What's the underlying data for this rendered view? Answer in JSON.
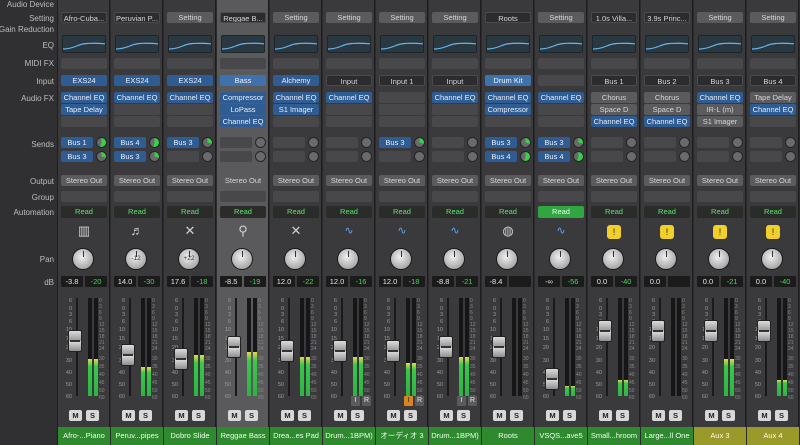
{
  "row_labels": {
    "audio_device": "Audio Device",
    "setting": "Setting",
    "gain_reduction": "Gain Reduction",
    "eq": "EQ",
    "midi_fx": "MIDI FX",
    "input": "Input",
    "audio_fx": "Audio FX",
    "sends": "Sends",
    "output": "Output",
    "group": "Group",
    "automation": "Automation",
    "pan": "Pan",
    "db": "dB"
  },
  "fader_scale": [
    "6",
    "0",
    "3",
    "6",
    "10",
    "15",
    "20",
    "30",
    "40",
    "50",
    "60"
  ],
  "meter_scale": [
    "0",
    "3",
    "6",
    "9",
    "12",
    "15",
    "18",
    "21",
    "24",
    "30",
    "35",
    "40",
    "45",
    "50",
    "60"
  ],
  "strips": [
    {
      "setting": "Afro-Cuba...",
      "setting_style": "dark",
      "input": "EXS24",
      "input_style": "blue",
      "audio_fx": [
        "Channel EQ",
        "Tape Delay"
      ],
      "sends": [
        {
          "label": "Bus 1",
          "knob": "g2"
        },
        {
          "label": "Bus 3",
          "knob": "g"
        }
      ],
      "output": "Stereo Out",
      "automation": "Read",
      "icon": "▥",
      "icon_name": "piano-icon",
      "icon_style": "",
      "pan": "",
      "db_left": "-3.8",
      "db_right": "-20",
      "fader": 0.6,
      "meter": 0.38,
      "io": [],
      "name": "Afro-...Piano",
      "name_style": ""
    },
    {
      "setting": "Peruvian P...",
      "setting_style": "dark",
      "input": "EXS24",
      "input_style": "blue",
      "audio_fx": [
        "Channel EQ"
      ],
      "sends": [
        {
          "label": "Bus 4",
          "knob": "g2"
        },
        {
          "label": "Bus 3",
          "knob": "g"
        }
      ],
      "output": "Stereo Out",
      "automation": "Read",
      "icon": "♬",
      "icon_name": "pan-flute-icon",
      "icon_style": "",
      "pan": "-12",
      "db_left": "14.0",
      "db_right": "-30",
      "fader": 0.42,
      "meter": 0.3,
      "io": [],
      "name": "Peruv...pipes",
      "name_style": ""
    },
    {
      "setting": "Setting",
      "setting_style": "gray",
      "input": "EXS24",
      "input_style": "blue",
      "audio_fx": [
        "Channel EQ"
      ],
      "sends": [
        {
          "label": "Bus 3",
          "knob": "g"
        }
      ],
      "output": "Stereo Out",
      "automation": "Read",
      "icon": "✕",
      "icon_name": "guitar-icon",
      "icon_style": "",
      "pan": "+22",
      "db_left": "17.6",
      "db_right": "-18",
      "fader": 0.38,
      "meter": 0.42,
      "io": [],
      "name": "Dobro Slide",
      "name_style": ""
    },
    {
      "setting": "Reggae B...",
      "setting_style": "dark",
      "input": "Bass",
      "input_style": "bluelight",
      "audio_fx": [
        "Compressor",
        "LoPass",
        "Channel EQ"
      ],
      "sends": [],
      "output": "Stereo Out",
      "automation": "Read",
      "icon": "⚲",
      "icon_name": "bass-guitar-icon",
      "icon_style": "",
      "pan": "",
      "db_left": "-8.5",
      "db_right": "-19",
      "fader": 0.52,
      "meter": 0.45,
      "io": [],
      "name": "Reggae Bass",
      "name_style": ""
    },
    {
      "setting": "Setting",
      "setting_style": "gray",
      "input": "Alchemy",
      "input_style": "blue",
      "audio_fx": [
        "Channel EQ",
        "S1 Imager"
      ],
      "sends": [],
      "output": "Stereo Out",
      "automation": "Read",
      "icon": "✕",
      "icon_name": "synth-icon",
      "icon_style": "",
      "pan": "",
      "db_left": "12.0",
      "db_right": "-22",
      "fader": 0.48,
      "meter": 0.4,
      "io": [],
      "name": "Drea...es Pad",
      "name_style": ""
    },
    {
      "setting": "Setting",
      "setting_style": "gray",
      "input": "Input",
      "input_style": "dark",
      "audio_fx": [
        "Channel EQ"
      ],
      "sends": [],
      "output": "Stereo Out",
      "automation": "Read",
      "icon": "∿",
      "icon_name": "waveform-icon",
      "icon_style": "wave",
      "pan": "",
      "db_left": "12.0",
      "db_right": "-16",
      "fader": 0.48,
      "meter": 0.4,
      "io": [
        {
          "label": "I",
          "style": ""
        },
        {
          "label": "R",
          "style": ""
        }
      ],
      "name": "Drum...1BPM)",
      "name_style": ""
    },
    {
      "setting": "Setting",
      "setting_style": "gray",
      "input": "Input 1",
      "input_style": "dark",
      "audio_fx": [],
      "sends": [
        {
          "label": "Bus 3",
          "knob": "g"
        }
      ],
      "output": "Stereo Out",
      "automation": "Read",
      "icon": "∿",
      "icon_name": "waveform-icon",
      "icon_style": "wave",
      "pan": "",
      "db_left": "12.0",
      "db_right": "-18",
      "fader": 0.48,
      "meter": 0.34,
      "io": [
        {
          "label": "I",
          "style": "rec"
        },
        {
          "label": "R",
          "style": ""
        }
      ],
      "name": "オーディオ 3",
      "name_style": ""
    },
    {
      "setting": "Setting",
      "setting_style": "gray",
      "input": "Input",
      "input_style": "dark",
      "audio_fx": [
        "Channel EQ"
      ],
      "sends": [],
      "output": "Stereo Out",
      "automation": "Read",
      "icon": "∿",
      "icon_name": "waveform-icon",
      "icon_style": "wave",
      "pan": "",
      "db_left": "-8.8",
      "db_right": "-21",
      "fader": 0.52,
      "meter": 0.4,
      "io": [
        {
          "label": "I",
          "style": ""
        },
        {
          "label": "R",
          "style": ""
        }
      ],
      "name": "Drum...1BPM)",
      "name_style": ""
    },
    {
      "setting": "Roots",
      "setting_style": "dark",
      "input": "Drum Kit",
      "input_style": "bluelight",
      "audio_fx": [
        "Channel EQ",
        "Compressor"
      ],
      "sends": [
        {
          "label": "Bus 3",
          "knob": "g"
        },
        {
          "label": "Bus 4",
          "knob": "g2"
        }
      ],
      "output": "Stereo Out",
      "automation": "Read",
      "icon": "◍",
      "icon_name": "drum-kit-icon",
      "icon_style": "",
      "pan": "",
      "db_left": "-8.4",
      "db_right": "",
      "fader": 0.52,
      "meter": 0.0,
      "io": [],
      "name": "Roots",
      "name_style": ""
    },
    {
      "setting": "Setting",
      "setting_style": "gray",
      "input": "",
      "input_style": "empty",
      "audio_fx": [
        "Channel EQ"
      ],
      "sends": [
        {
          "label": "Bus 3",
          "knob": "g"
        },
        {
          "label": "Bus 4",
          "knob": "g2"
        }
      ],
      "output": "Stereo Out",
      "automation": "Read",
      "icon": "∿",
      "icon_name": "waveform-icon",
      "icon_style": "wave",
      "pan": "",
      "db_left": "-∞",
      "db_right": "-56",
      "fader": 0.12,
      "meter": 0.1,
      "io": [],
      "name": "VSQS...ave5",
      "name_style": "",
      "auto_on": true
    },
    {
      "setting": "1.0s Villa...",
      "setting_style": "dark",
      "input": "Bus 1",
      "input_style": "dark",
      "audio_fx": [
        "Chorus",
        "Space D",
        "Channel EQ"
      ],
      "sends": [],
      "output": "Stereo Out",
      "automation": "Read",
      "icon": "!",
      "icon_name": "aux-icon",
      "icon_style": "yellow",
      "pan": "",
      "db_left": "0.0",
      "db_right": "-40",
      "fader": 0.72,
      "meter": 0.16,
      "io": [],
      "name": "Small...hroom",
      "name_style": ""
    },
    {
      "setting": "3.9s Princ...",
      "setting_style": "dark",
      "input": "Bus 2",
      "input_style": "dark",
      "audio_fx": [
        "Chorus",
        "Space D",
        "Channel EQ"
      ],
      "sends": [],
      "output": "Stereo Out",
      "automation": "Read",
      "icon": "!",
      "icon_name": "aux-icon",
      "icon_style": "yellow",
      "pan": "",
      "db_left": "0.0",
      "db_right": "",
      "fader": 0.72,
      "meter": 0.0,
      "io": [],
      "name": "Large...ll One",
      "name_style": ""
    },
    {
      "setting": "Setting",
      "setting_style": "gray",
      "input": "Bus 3",
      "input_style": "dark",
      "audio_fx": [
        "Channel EQ",
        "IR-L (m)",
        "S1 Imager"
      ],
      "sends": [],
      "output": "Stereo Out",
      "automation": "Read",
      "icon": "!",
      "icon_name": "aux-icon",
      "icon_style": "yellow",
      "pan": "",
      "db_left": "0.0",
      "db_right": "-21",
      "fader": 0.72,
      "meter": 0.38,
      "io": [],
      "name": "Aux 3",
      "name_style": "yel"
    },
    {
      "setting": "Setting",
      "setting_style": "gray",
      "input": "Bus 4",
      "input_style": "dark",
      "audio_fx": [
        "Tape Delay",
        "Channel EQ"
      ],
      "sends": [],
      "output": "Stereo Out",
      "automation": "Read",
      "icon": "!",
      "icon_name": "aux-icon",
      "icon_style": "yellow",
      "pan": "",
      "db_left": "0.0",
      "db_right": "-40",
      "fader": 0.72,
      "meter": 0.16,
      "io": [],
      "name": "Aux 4",
      "name_style": "yel"
    }
  ],
  "mute_label": "M",
  "solo_label": "S"
}
